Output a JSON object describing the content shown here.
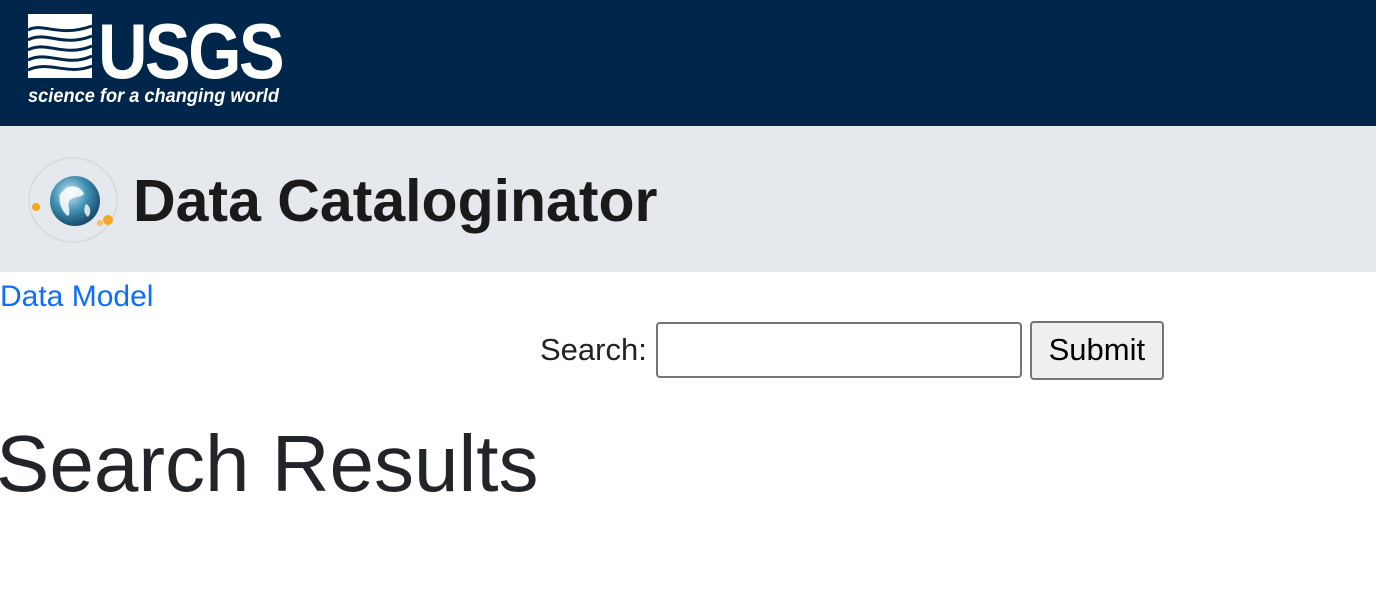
{
  "header": {
    "logo_text": "USGS",
    "logo_tagline": "science for a changing world",
    "background_color": "#00264c",
    "logo_icon": "usgs-wave-logo-icon"
  },
  "site": {
    "title": "Data Cataloginator",
    "logo_icon": "globe-orbit-icon",
    "banner_color": "#e5e8ec"
  },
  "nav": {
    "data_model_link": "Data Model",
    "link_color": "#0d6efd"
  },
  "search": {
    "label": "Search:",
    "input_value": "",
    "placeholder": "",
    "submit_label": "Submit"
  },
  "results": {
    "heading": "Search Results"
  }
}
